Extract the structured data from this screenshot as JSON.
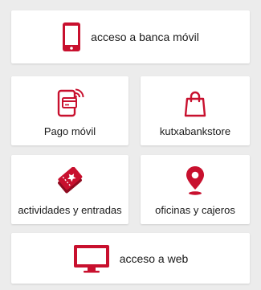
{
  "colors": {
    "accent": "#c8102e",
    "background": "#ececec",
    "card": "#ffffff",
    "text": "#1a1a1a"
  },
  "menu": {
    "banca_movil": {
      "label": "acceso a banca móvil",
      "icon": "smartphone-icon"
    },
    "pago_movil": {
      "label": "Pago móvil",
      "icon": "mobile-payment-icon"
    },
    "store": {
      "label": "kutxabankstore",
      "icon": "shopping-bag-icon"
    },
    "actividades": {
      "label": "actividades y entradas",
      "icon": "tickets-icon"
    },
    "oficinas": {
      "label": "oficinas y cajeros",
      "icon": "location-pin-icon"
    },
    "web": {
      "label": "acceso a web",
      "icon": "monitor-icon"
    }
  }
}
